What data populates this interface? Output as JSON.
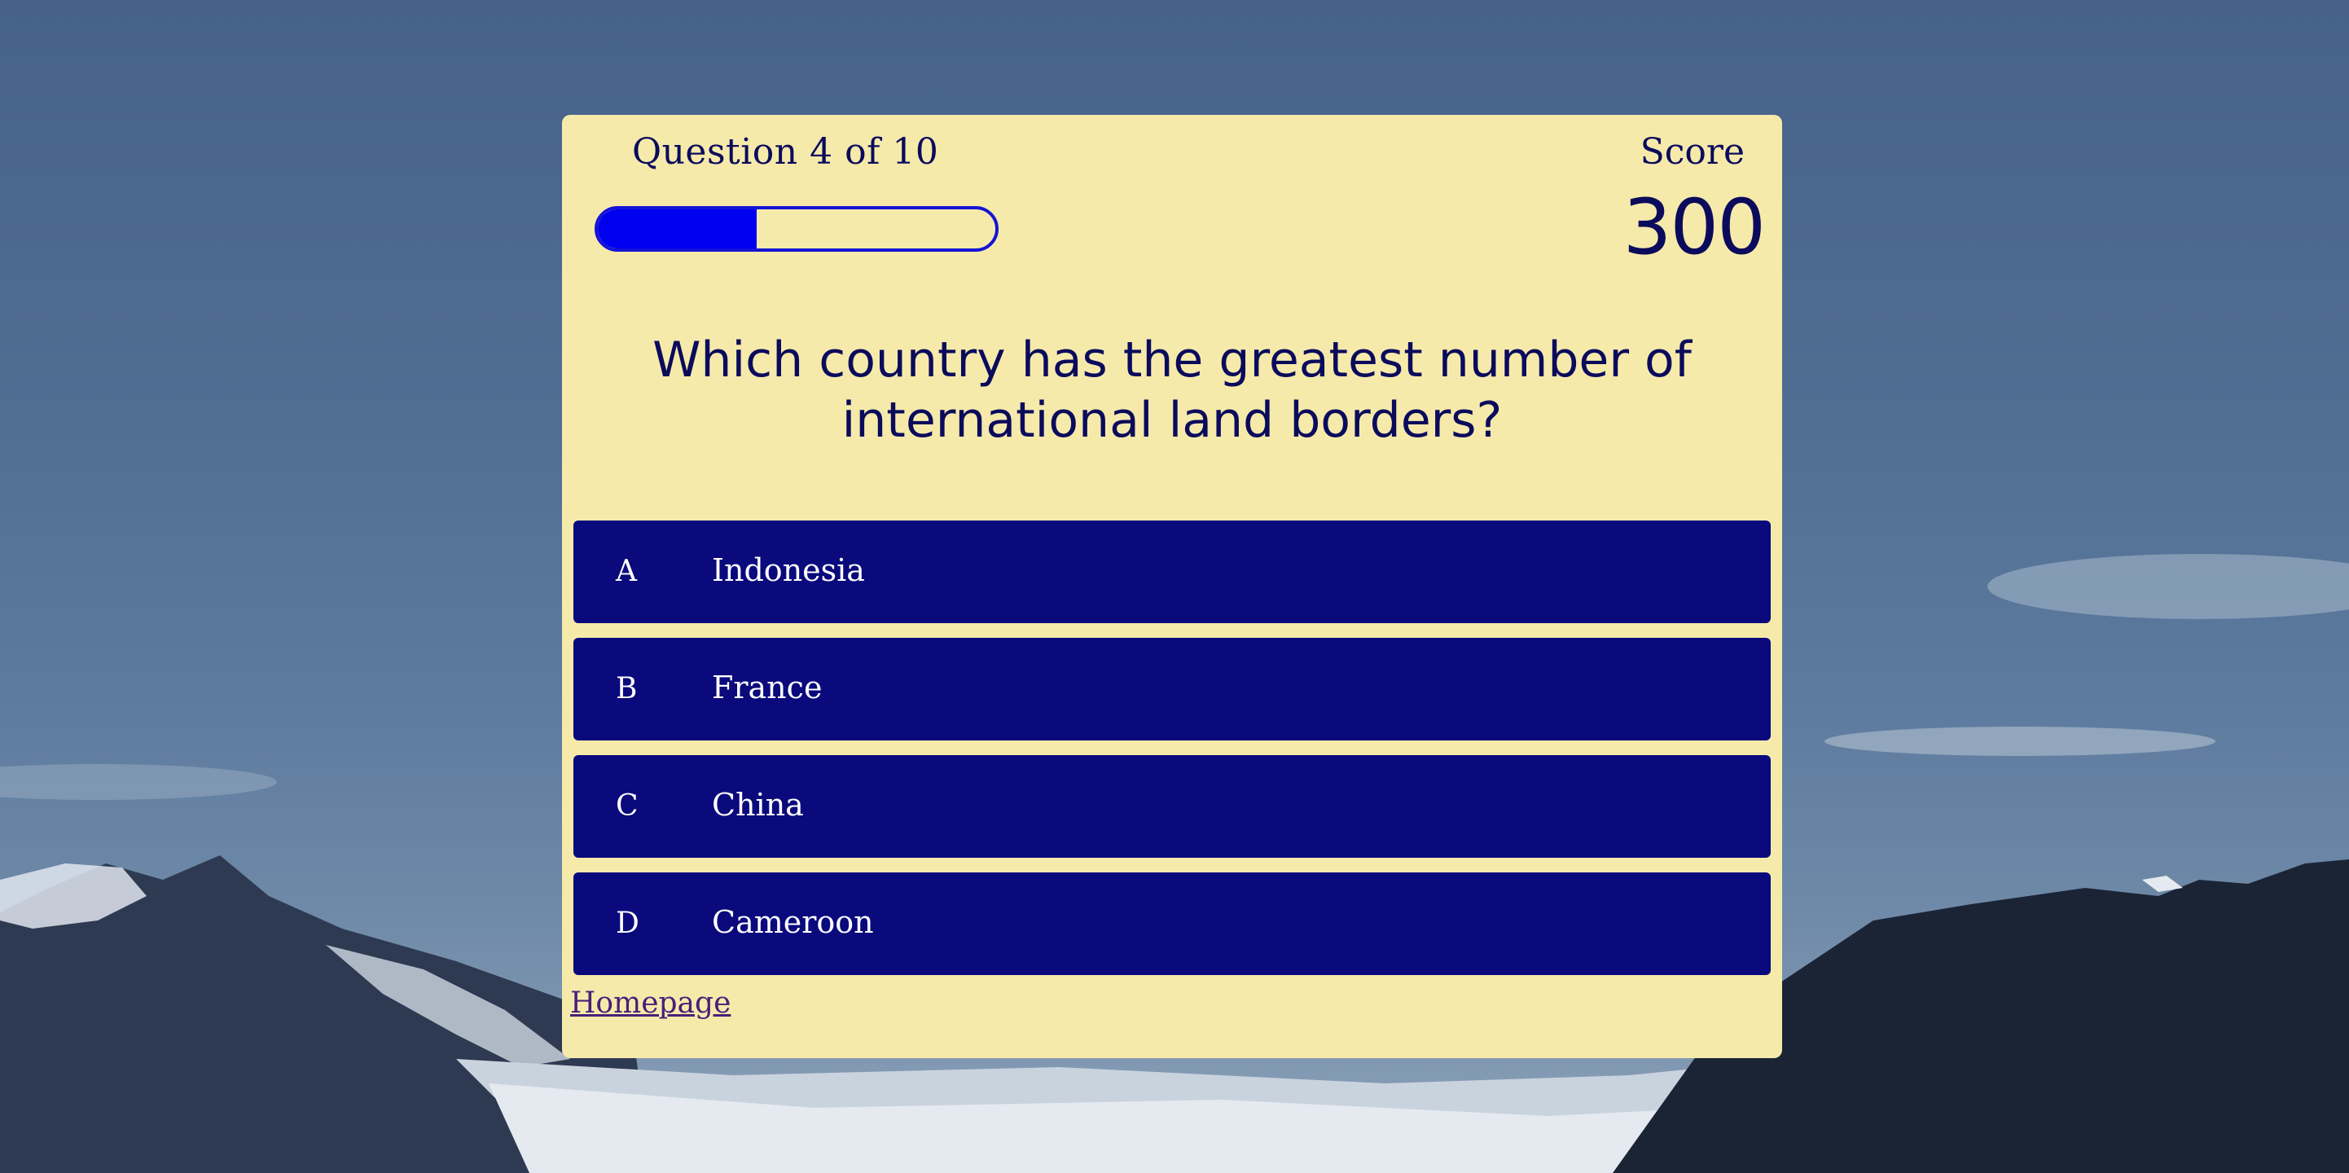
{
  "header": {
    "question_counter": "Question 4 of 10",
    "progress_fraction": 0.4,
    "score_label": "Score",
    "score_value": "300"
  },
  "question": {
    "text": "Which country has the greatest number of international land borders?"
  },
  "answers": [
    {
      "letter": "A",
      "text": "Indonesia"
    },
    {
      "letter": "B",
      "text": "France"
    },
    {
      "letter": "C",
      "text": "China"
    },
    {
      "letter": "D",
      "text": "Cameroon"
    }
  ],
  "footer": {
    "home_link": "Homepage"
  },
  "colors": {
    "card_background": "#f6eaab",
    "answer_background": "#0a0a7d",
    "text_dark": "#0b0b5c",
    "progress_fill": "#0000f0",
    "link": "#4a1f7a"
  }
}
